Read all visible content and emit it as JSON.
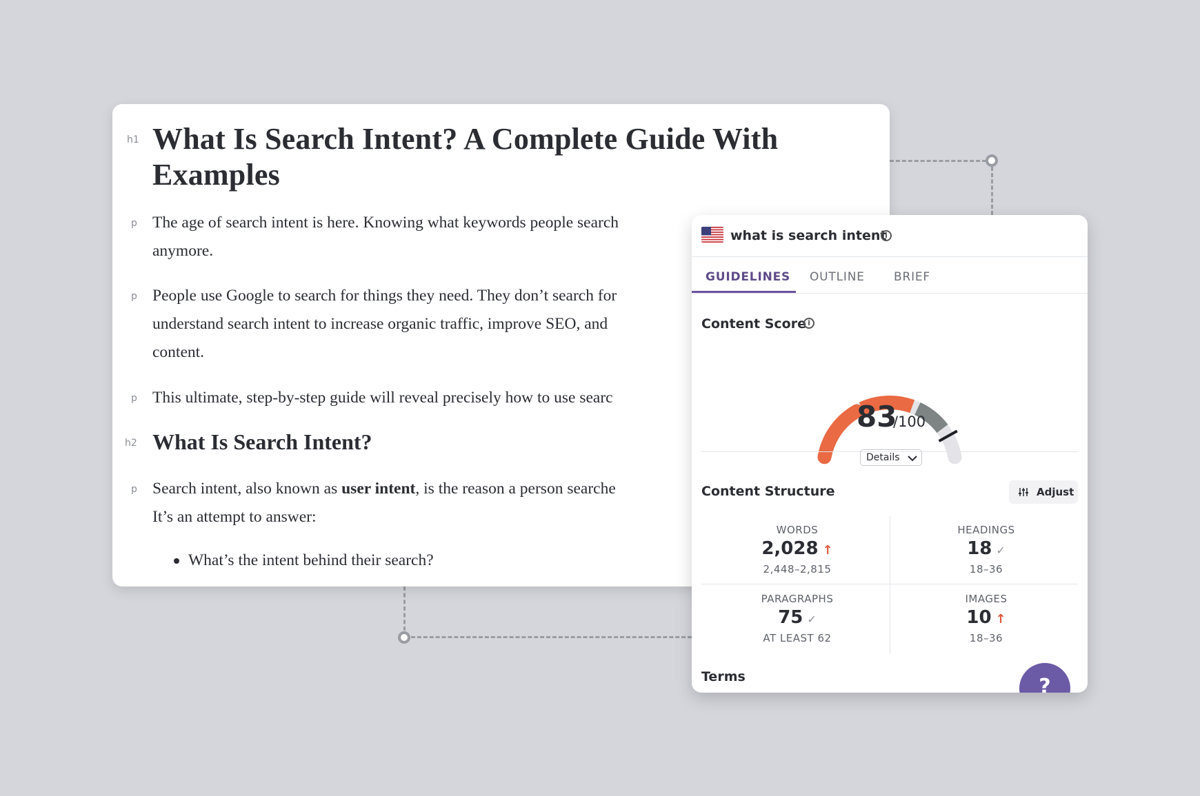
{
  "editor": {
    "h1_tag": "h1",
    "title_line1": "What Is Search Intent? A Complete Guide With",
    "title_line2": "Examples",
    "p_tag": "p",
    "h2_tag": "h2",
    "p1_line1": "The age of search intent is here. Knowing what keywords people search",
    "p1_line2": "anymore.",
    "p2_line1": "People use Google to search for things they need. They don’t search for",
    "p2_line2": "understand search intent to increase organic traffic, improve SEO, and",
    "p2_line3": "content.",
    "p3_line1": "This ultimate, step-by-step guide will reveal precisely how to use searc",
    "heading2": "What Is Search Intent?",
    "p4_before": "Search intent, also known as ",
    "p4_bold": "user intent",
    "p4_after": ", is the reason a person searche",
    "p4_line2": "It’s an attempt to answer:",
    "bullet1": "What’s the intent behind their search?"
  },
  "panel": {
    "keyword": "what is search intent",
    "info_glyph": "i",
    "tabs": [
      {
        "label": "GUIDELINES",
        "active": true
      },
      {
        "label": "OUTLINE",
        "active": false
      },
      {
        "label": "BRIEF",
        "active": false
      }
    ],
    "content_score_title": "Content Score",
    "score": "83",
    "score_max": "/100",
    "score_value": 83,
    "score_target_fraction": 0.88,
    "details_label": "Details",
    "content_structure_title": "Content Structure",
    "adjust_label": "Adjust",
    "stats": [
      {
        "label": "WORDS",
        "value": "2,028",
        "status": "up",
        "range": "2,448–2,815"
      },
      {
        "label": "HEADINGS",
        "value": "18",
        "status": "check",
        "range": "18–36"
      },
      {
        "label": "PARAGRAPHS",
        "value": "75",
        "status": "check",
        "range": "AT LEAST 62"
      },
      {
        "label": "IMAGES",
        "value": "10",
        "status": "up",
        "range": "18–36"
      }
    ],
    "terms_title": "Terms",
    "help_glyph": "?",
    "colors": {
      "accent": "#6a55a0",
      "score_orange": "#ea6a43",
      "score_grey": "#7d8483",
      "track": "#e4e4e8",
      "arrow_up": "#e0573a"
    }
  }
}
